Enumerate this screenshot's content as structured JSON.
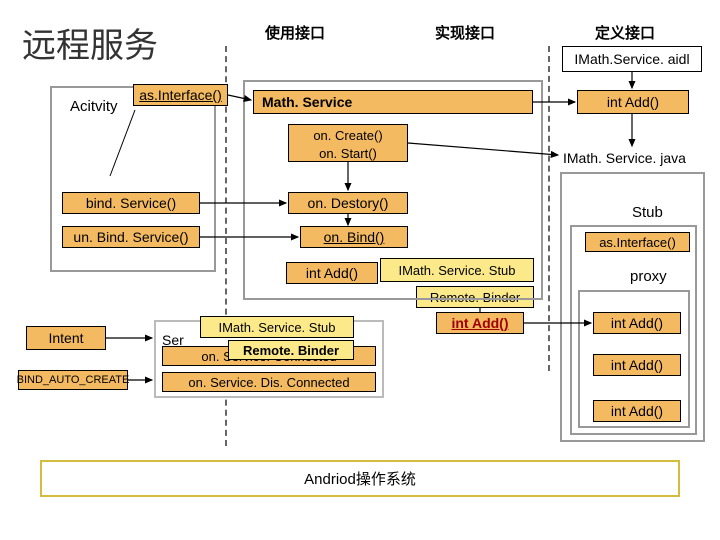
{
  "title": "远程服务",
  "headers": {
    "use": "使用接口",
    "impl": "实现接口",
    "def": "定义接口"
  },
  "aidl_label": "IMath.Service. aidl",
  "activity": "Acitvity",
  "asInterface": "as.Interface()",
  "mathservice": "Math. Service",
  "intAdd": "int Add()",
  "lifecycle": {
    "onCreate": "on. Create()",
    "onStart": "on. Start()",
    "onDestroy": "on. Destory()",
    "onBind": "on. Bind()"
  },
  "java_label": "IMath. Service. java",
  "bindService": "bind. Service()",
  "unbindService": "un. Bind. Service()",
  "stubLabel": "Stub",
  "asInterface2": "as.Interface()",
  "proxyLabel": "proxy",
  "stubClass": "IMath. Service. Stub",
  "remoteBinder": "Remote. Binder",
  "intAdd_red": "int Add()",
  "intent": "Intent",
  "bindAutoCreate": "BIND_AUTO_CREATE",
  "serviceConnection": {
    "ser": "Ser",
    "line1": "on. Service. Connected",
    "line2": "on. Service. Dis. Connected"
  },
  "stubInner": "IMath. Service. Stub",
  "remoteBinderInner": "Remote. Binder",
  "footer": "Andriod操作系统"
}
